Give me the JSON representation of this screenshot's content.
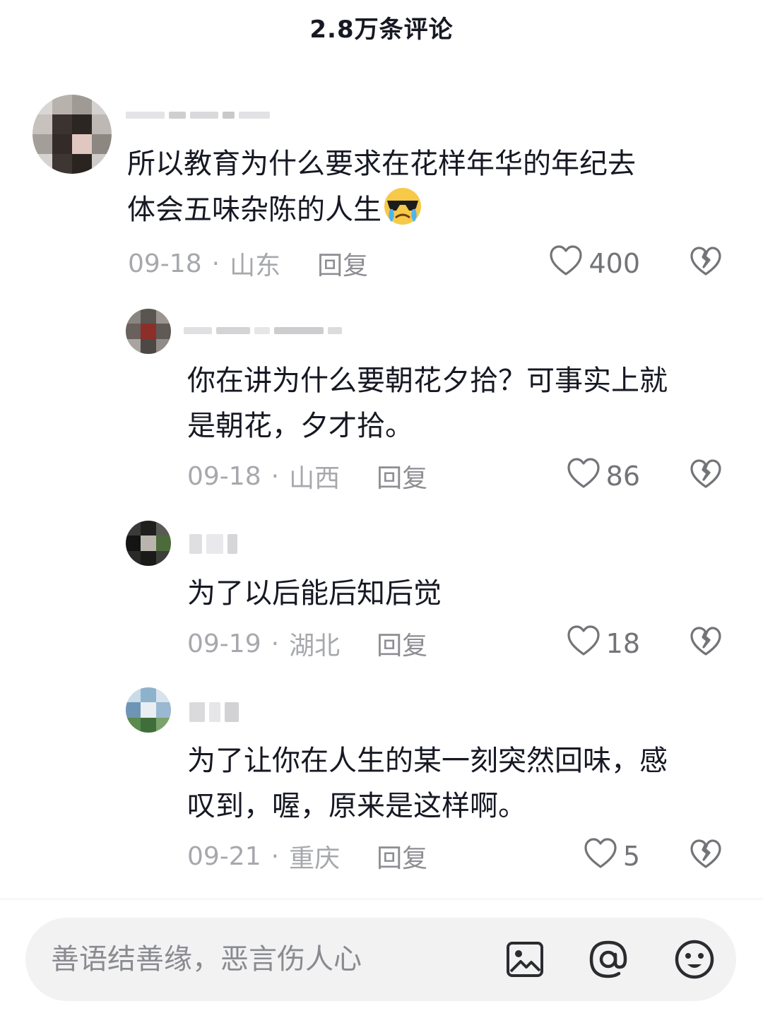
{
  "header": {
    "title": "2.8万条评论"
  },
  "comments": [
    {
      "text_line1": "所以教育为什么要求在花样年华的年纪去",
      "text_line2": "体会五味杂陈的人生",
      "emoji": "sunglasses-crying-face",
      "date": "09-18",
      "dot": "·",
      "location": "山东",
      "reply_label": "回复",
      "likes": "400"
    },
    {
      "text_line1": "你在讲为什么要朝花夕拾？可事实上就",
      "text_line2": "是朝花，夕才拾。",
      "date": "09-18",
      "dot": "·",
      "location": "山西",
      "reply_label": "回复",
      "likes": "86"
    },
    {
      "text_line1": "为了以后能后知后觉",
      "date": "09-19",
      "dot": "·",
      "location": "湖北",
      "reply_label": "回复",
      "likes": "18"
    },
    {
      "text_line1": "为了让你在人生的某一刻突然回味，感",
      "text_line2": "叹到，喔，原来是这样啊。",
      "date": "09-21",
      "dot": "·",
      "location": "重庆",
      "reply_label": "回复",
      "likes": "5"
    }
  ],
  "input_bar": {
    "placeholder": "善语结善缘，恶言伤人心",
    "icons": [
      "image-icon",
      "at-icon",
      "emoji-icon"
    ]
  },
  "colors": {
    "text": "#161823",
    "meta": "#a7a8ad",
    "bar_bg": "#f2f2f3"
  }
}
